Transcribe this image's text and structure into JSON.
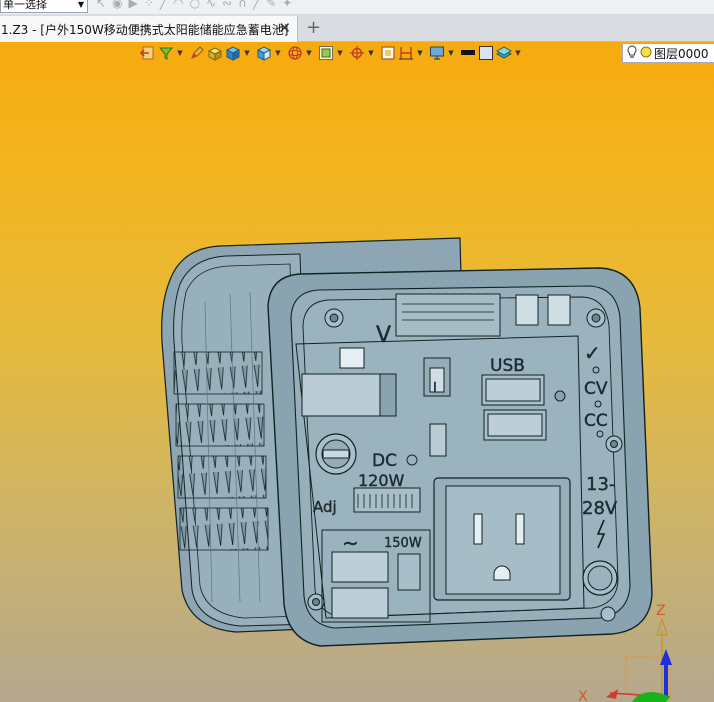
{
  "toolbar": {
    "selection_mode": "单一选择"
  },
  "tabs": [
    {
      "title": "1.Z3 - [户外150W移动便携式太阳能储能应急蓄电池]",
      "active": true
    }
  ],
  "tab_add_glyph": "+",
  "tab_close_glyph": "✕",
  "view_toolbar": {
    "layer_name": "图层0000",
    "icons": [
      "exit-icon",
      "filter-icon",
      "pencil-icon",
      "shaded-box-icon",
      "solid-cube-icon",
      "display-cube-icon",
      "wire-sphere-icon",
      "view-frame-icon",
      "target-icon",
      "frame-square-icon",
      "dimension-icon",
      "monitor-icon",
      "line-color-icon",
      "face-color-icon",
      "layers-icon"
    ]
  },
  "model_labels": {
    "voltage_mark": "V",
    "usb": "USB",
    "check": "✓",
    "cv": "CV",
    "cc": "CC",
    "dc": "DC",
    "dc_power": "120W",
    "adj": "Adj",
    "range_top": "13-",
    "range_bottom": "28V",
    "ac_power": "150W",
    "ac_wave": "~",
    "switch_mark": "I"
  },
  "axis_labels": {
    "z": "Z",
    "x": "X"
  },
  "colors": {
    "background_top": "#f6aa0e",
    "background_bottom": "#b5a88e",
    "model_body": "#93acb8",
    "model_edge": "#1a2a33",
    "axis_z": "#1f2ee0",
    "axis_x": "#d23b2e",
    "axis_y": "#1ab11a"
  }
}
